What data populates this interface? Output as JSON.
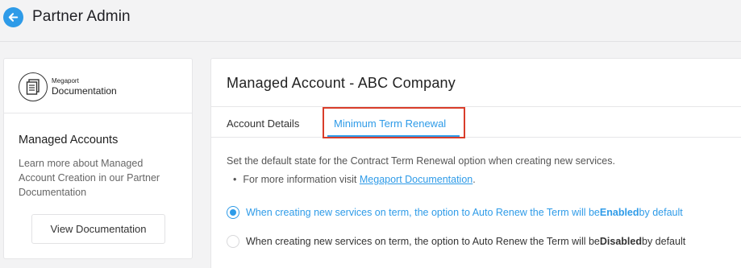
{
  "header": {
    "title": "Partner Admin",
    "back_icon": "arrow-left-icon",
    "accent": "#2e9be8"
  },
  "sidebar": {
    "logo": {
      "small": "Megaport",
      "big": "Documentation",
      "icon": "document-icon"
    },
    "heading": "Managed Accounts",
    "text": "Learn more about Managed Account Creation in our Partner Documentation",
    "button_label": "View Documentation"
  },
  "main": {
    "title": "Managed Account - ABC Company",
    "tabs": [
      {
        "label": "Account Details",
        "active": false
      },
      {
        "label": "Minimum Term Renewal",
        "active": true
      }
    ],
    "highlight_color": "#d93d2a",
    "description": "Set the default state for the Contract Term Renewal option when creating new services.",
    "bullet_prefix": "For more information visit ",
    "bullet_link": "Megaport Documentation",
    "bullet_suffix": ".",
    "options": [
      {
        "prefix": "When creating new services on term, the option to Auto Renew the Term will be ",
        "bold": "Enabled",
        "suffix": " by default",
        "selected": true
      },
      {
        "prefix": "When creating new services on term, the option to Auto Renew the Term will be ",
        "bold": "Disabled",
        "suffix": " by default",
        "selected": false
      }
    ]
  }
}
